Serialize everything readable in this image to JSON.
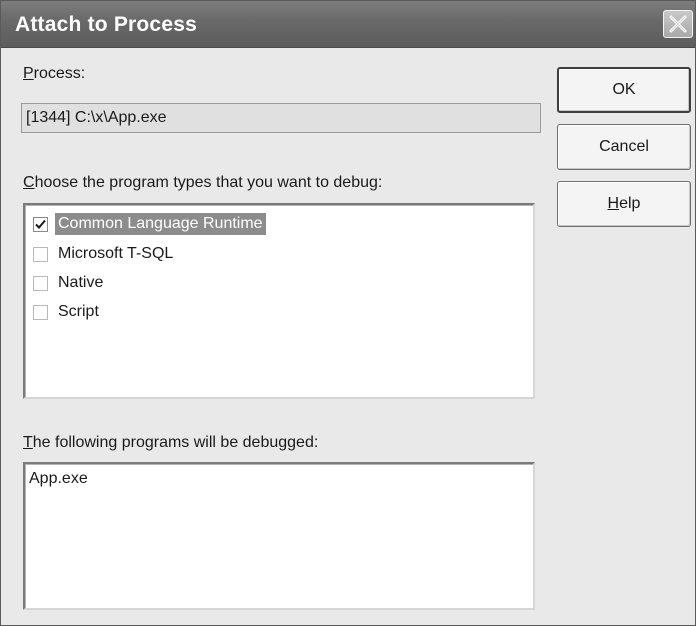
{
  "window": {
    "title": "Attach to Process"
  },
  "process": {
    "label_accel": "P",
    "label_rest": "rocess:",
    "value": "[1344] C:\\x\\App.exe"
  },
  "types": {
    "label_accel": "C",
    "label_rest": "hoose the program types that you want to debug:",
    "items": [
      {
        "label": "Common Language Runtime",
        "checked": true,
        "selected": true
      },
      {
        "label": "Microsoft T-SQL",
        "checked": false,
        "selected": false
      },
      {
        "label": "Native",
        "checked": false,
        "selected": false
      },
      {
        "label": "Script",
        "checked": false,
        "selected": false
      }
    ]
  },
  "programs": {
    "label_accel": "T",
    "label_rest": "he following programs will be debugged:",
    "items": [
      "App.exe"
    ]
  },
  "buttons": {
    "ok": "OK",
    "cancel": "Cancel",
    "help_accel": "H",
    "help_rest": "elp"
  },
  "icons": {
    "close": "close-icon",
    "checkmark": "checkmark-icon"
  }
}
